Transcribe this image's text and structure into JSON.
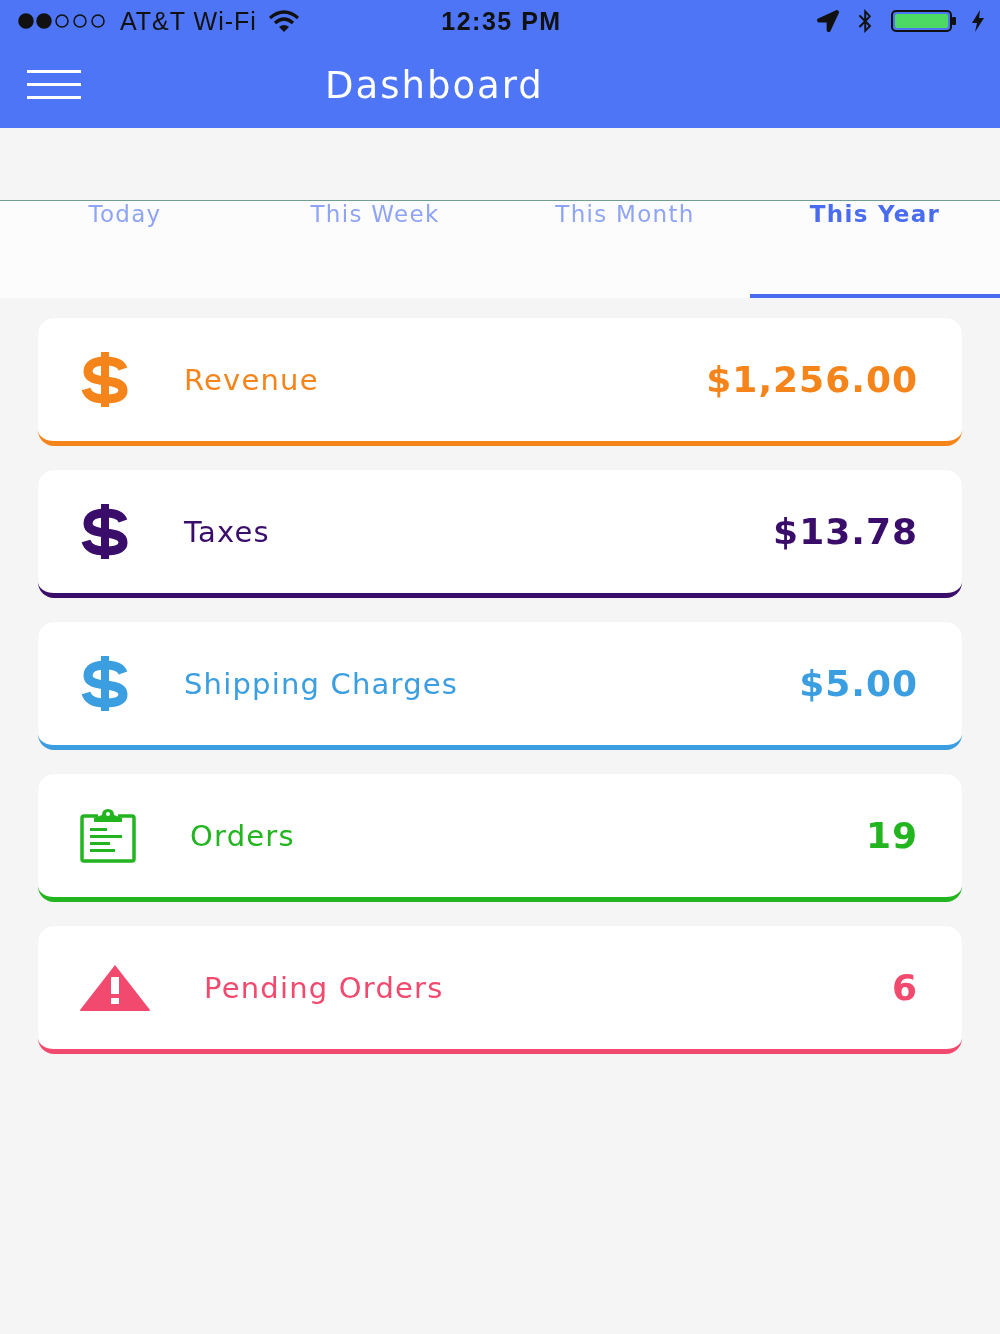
{
  "status_bar": {
    "carrier": "AT&T Wi-Fi",
    "time": "12:35 PM"
  },
  "header": {
    "title": "Dashboard"
  },
  "tabs": [
    {
      "label": "Today",
      "selected": false
    },
    {
      "label": "This Week",
      "selected": false
    },
    {
      "label": "This Month",
      "selected": false
    },
    {
      "label": "This Year",
      "selected": true
    }
  ],
  "cards": [
    {
      "kind": "dollar",
      "label": "Revenue",
      "value": "$1,256.00",
      "color": "#f5841a"
    },
    {
      "kind": "dollar",
      "label": "Taxes",
      "value": "$13.78",
      "color": "#3b0d6b"
    },
    {
      "kind": "dollar",
      "label": "Shipping Charges",
      "value": "$5.00",
      "color": "#3a9ee0"
    },
    {
      "kind": "clipboard",
      "label": "Orders",
      "value": "19",
      "color": "#22b51f"
    },
    {
      "kind": "warning",
      "label": "Pending Orders",
      "value": "6",
      "color": "#f24a6e"
    }
  ]
}
